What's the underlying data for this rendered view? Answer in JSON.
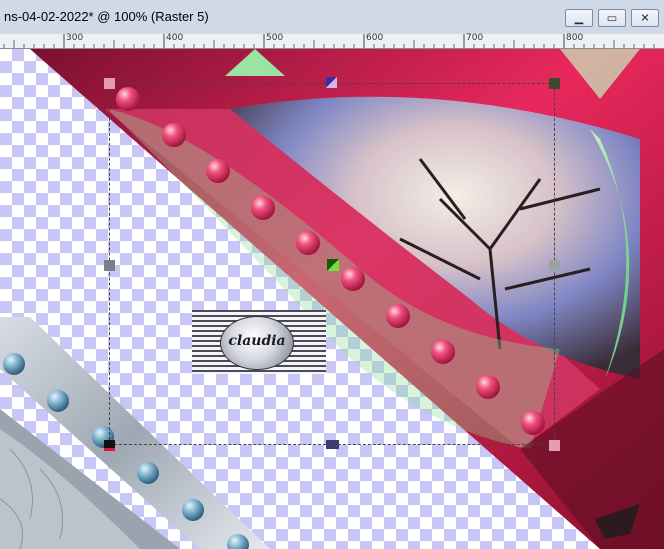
{
  "window": {
    "title": "ns-04-02-2022* @ 100% (Raster 5)",
    "buttons": {
      "minimize": "minimize-icon",
      "maximize": "maximize-icon",
      "close": "close-icon"
    }
  },
  "ruler": {
    "ticks": [
      "300",
      "400",
      "500",
      "600",
      "700",
      "800"
    ]
  },
  "watermark": {
    "text": "claudia"
  },
  "colors": {
    "accent_pink": "#e8285c",
    "accent_green": "#8ee29a",
    "checker": "#c8c6f7",
    "titlebar": "#cfd9e8"
  }
}
